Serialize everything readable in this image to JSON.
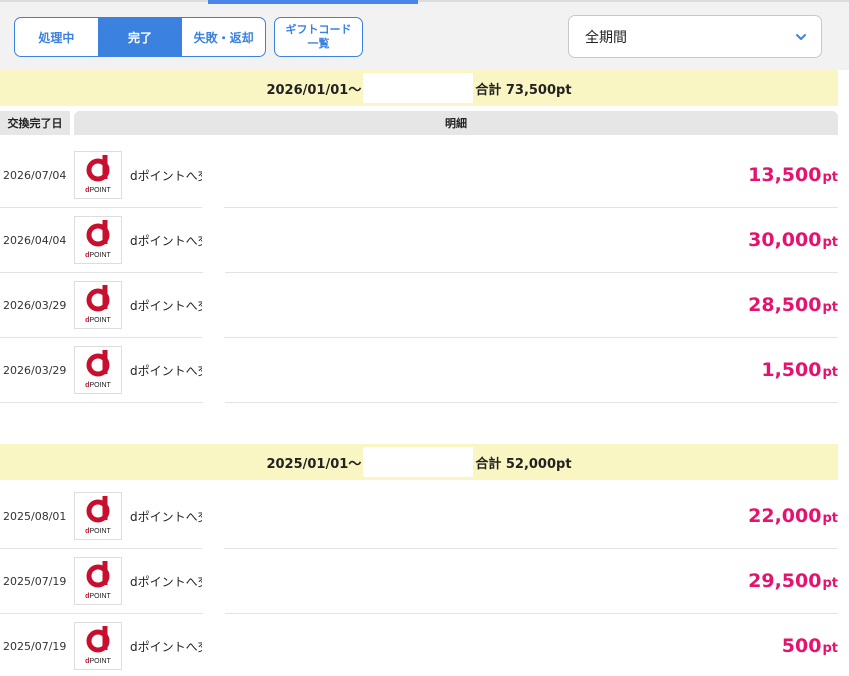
{
  "tabs": {
    "processing": "処理中",
    "complete": "完了",
    "failed": "失敗・返却",
    "gift_codes": "ギフトコード\n一覧"
  },
  "period_select": {
    "value": "全期間"
  },
  "table_headers": {
    "date": "交換完了日",
    "detail": "明細"
  },
  "groups": [
    {
      "start": "2026/01/01〜",
      "total": "合計 73,500pt",
      "rows": [
        {
          "date": "2026/07/04",
          "label": "dポイントへ交換",
          "amount": "13,500",
          "unit": "pt"
        },
        {
          "date": "2026/04/04",
          "label": "dポイントへ交換",
          "amount": "30,000",
          "unit": "pt"
        },
        {
          "date": "2026/03/29",
          "label": "dポイントへ交換",
          "amount": "28,500",
          "unit": "pt"
        },
        {
          "date": "2026/03/29",
          "label": "dポイントへ交換",
          "amount": "1,500",
          "unit": "pt"
        }
      ]
    },
    {
      "start": "2025/01/01〜",
      "total": "合計 52,000pt",
      "rows": [
        {
          "date": "2025/08/01",
          "label": "dポイントへ交換",
          "amount": "22,000",
          "unit": "pt"
        },
        {
          "date": "2025/07/19",
          "label": "dポイントへ交換",
          "amount": "29,500",
          "unit": "pt"
        },
        {
          "date": "2025/07/19",
          "label": "dポイントへ交換",
          "amount": "500",
          "unit": "pt"
        }
      ]
    }
  ],
  "logo": {
    "text": "POINT",
    "icon": "dpoint-logo-icon",
    "color": "#c8102e"
  },
  "colors": {
    "accent": "#3b82e0",
    "amount": "#e6136e",
    "year_band": "#faf6c3"
  }
}
